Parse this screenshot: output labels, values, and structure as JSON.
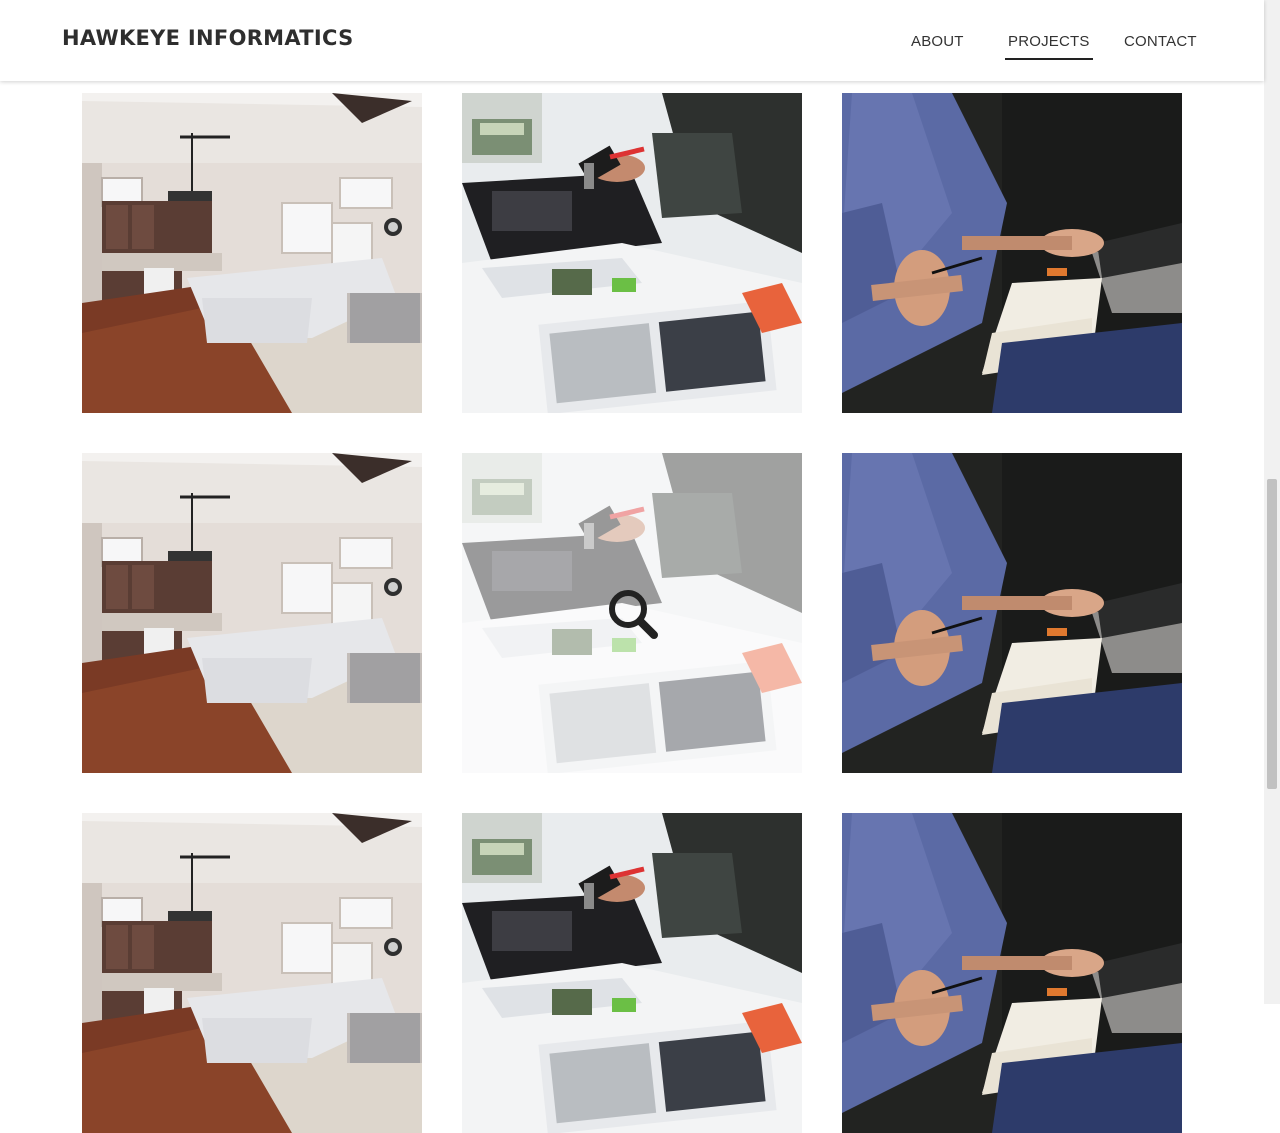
{
  "brand": {
    "title": "HAWKEYE INFORMATICS"
  },
  "nav": {
    "about": "ABOUT",
    "projects": "PROJECTS",
    "contact": "CONTACT",
    "active": "PROJECTS"
  },
  "gallery": {
    "tiles": [
      {
        "photo": "living-room-photo"
      },
      {
        "photo": "magazines-scissors-photo"
      },
      {
        "photo": "laptop-notebook-photo"
      },
      {
        "photo": "living-room-photo"
      },
      {
        "photo": "magazines-scissors-photo",
        "hovered": true,
        "icon": "search-icon"
      },
      {
        "photo": "laptop-notebook-photo"
      },
      {
        "photo": "living-room-photo"
      },
      {
        "photo": "magazines-scissors-photo"
      },
      {
        "photo": "laptop-notebook-photo"
      }
    ]
  },
  "colors": {
    "text": "#2e2e2e",
    "background": "#ffffff",
    "overlay": "#ffffff"
  }
}
